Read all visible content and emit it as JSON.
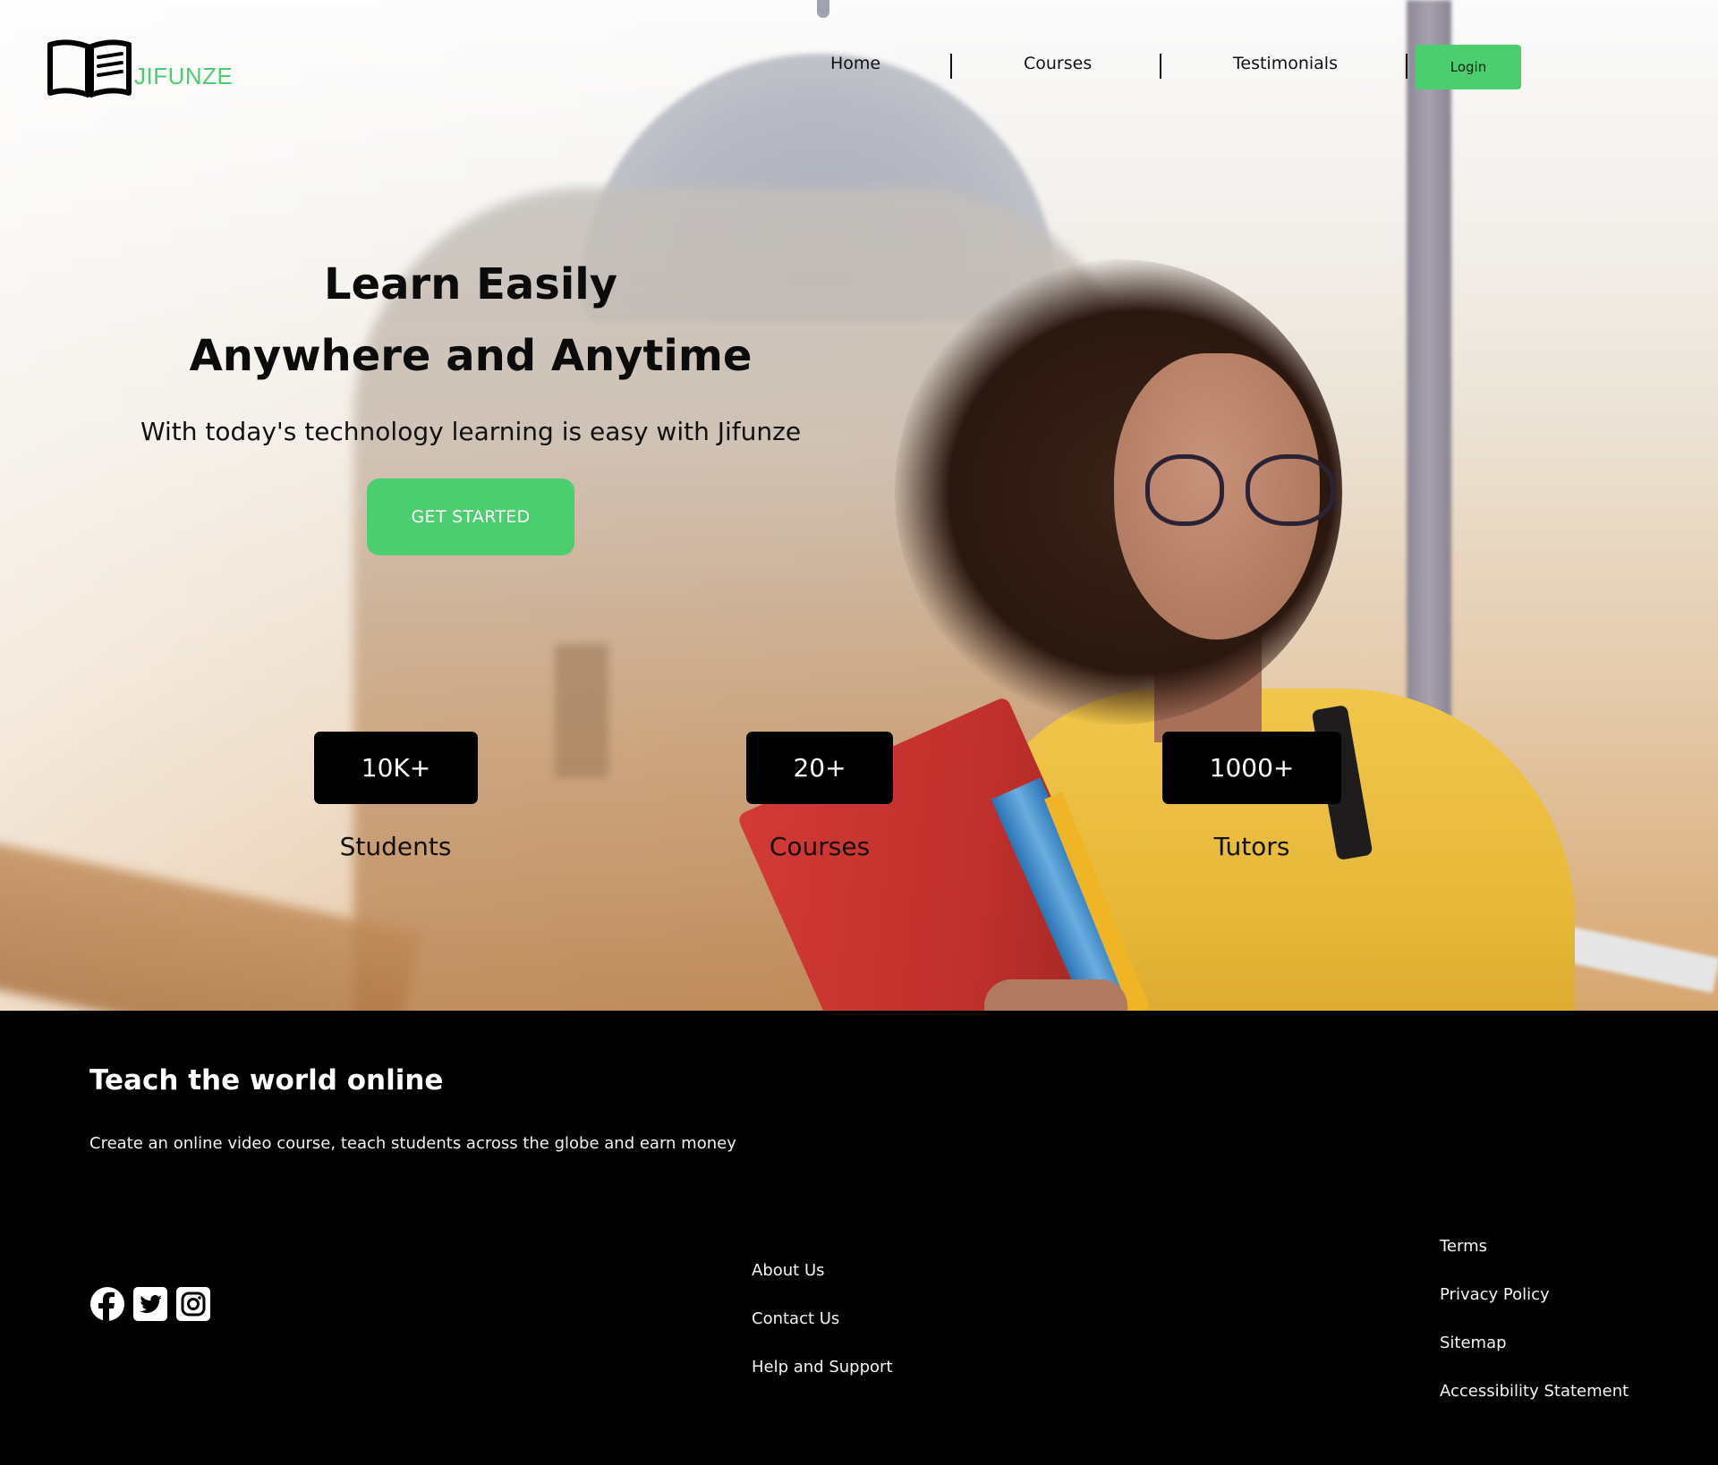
{
  "brand": {
    "name": "JIFUNZE",
    "accent": "#4ccd6f"
  },
  "nav": {
    "links": [
      "Home",
      "Courses",
      "Testimonials"
    ],
    "login_label": "Login"
  },
  "hero": {
    "title_line1": "Learn Easily",
    "title_line2": "Anywhere and Anytime",
    "subtitle": "With today's technology learning is easy with Jifunze",
    "cta_label": "GET STARTED"
  },
  "stats": [
    {
      "value": "10K+",
      "label": "Students"
    },
    {
      "value": "20+",
      "label": "Courses"
    },
    {
      "value": "1000+",
      "label": "Tutors"
    }
  ],
  "footer": {
    "title": "Teach the world online",
    "description": "Create an online video course, teach students across the globe and earn money",
    "social_icons": [
      "facebook-icon",
      "twitter-icon",
      "instagram-icon"
    ],
    "links_col1": [
      "About Us",
      "Contact Us",
      "Help and Support"
    ],
    "links_col2": [
      "Terms",
      "Privacy Policy",
      "Sitemap",
      "Accessibility Statement"
    ]
  }
}
